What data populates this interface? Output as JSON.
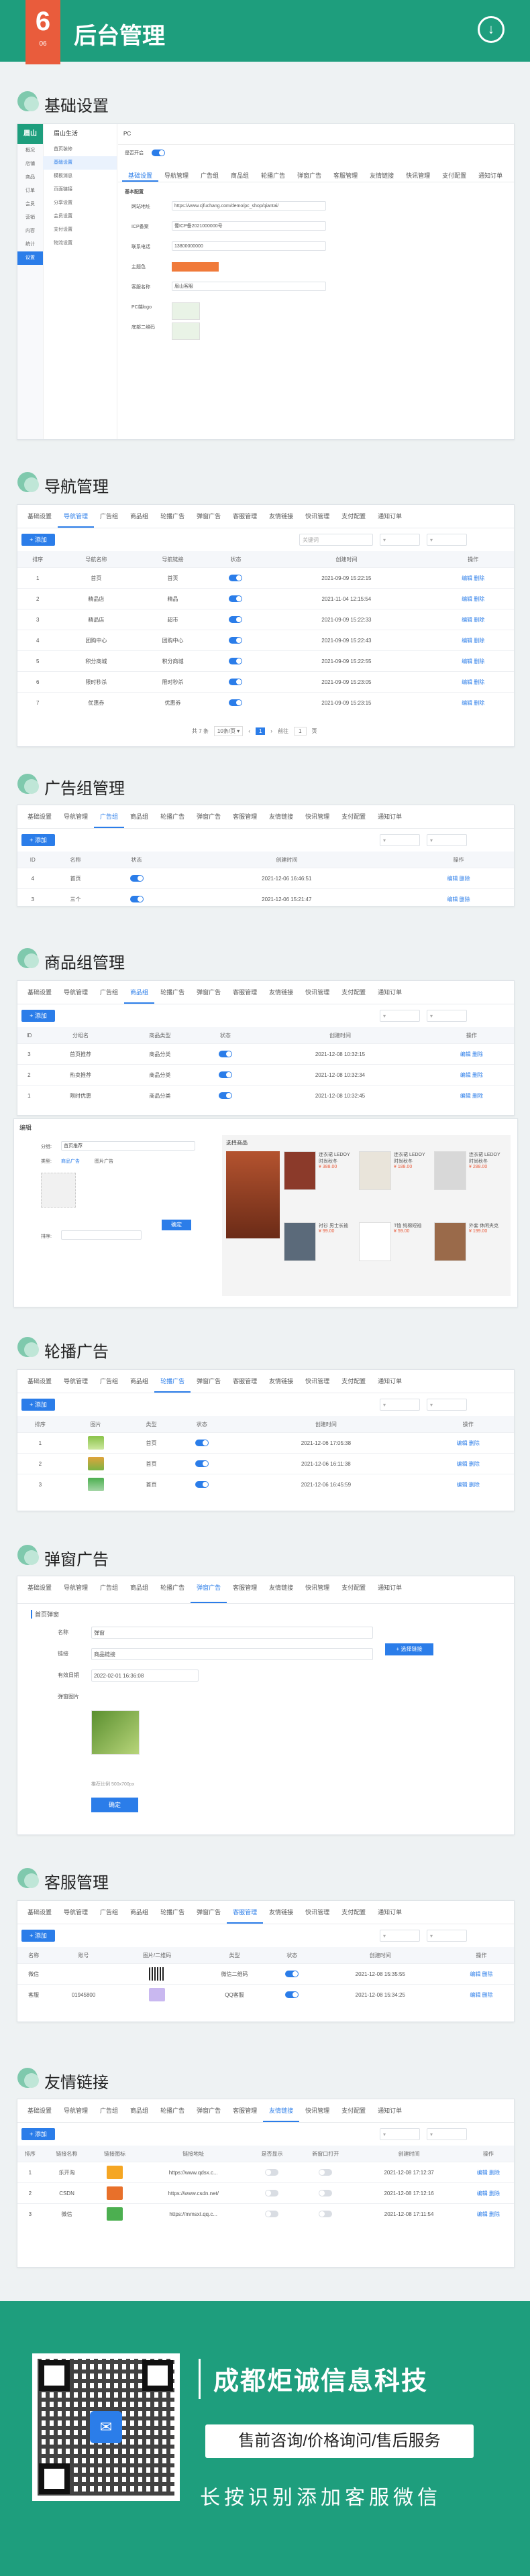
{
  "banner": {
    "number": "6",
    "number_sub": "06",
    "title": "后台管理",
    "down_icon": "arrow-down-circle-icon"
  },
  "sections": {
    "basic": "基础设置",
    "nav": "导航管理",
    "adgroup": "广告组管理",
    "goodsgroup": "商品组管理",
    "carousel": "轮播广告",
    "popup": "弹窗广告",
    "service": "客服管理",
    "links": "友情链接"
  },
  "tabs": [
    "基础设置",
    "导航管理",
    "广告组",
    "商品组",
    "轮播广告",
    "弹窗广告",
    "客服管理",
    "友情链接",
    "快讯管理",
    "支付配置",
    "通知订单"
  ],
  "common": {
    "add": "+ 添加",
    "search_ph": "关键词",
    "op_edit": "编辑",
    "op_del": "删除"
  },
  "basic_settings": {
    "logo": "眉山",
    "site_name": "眉山生活",
    "menu": [
      "概况",
      "店铺",
      "商品",
      "订单",
      "会员",
      "营销",
      "内容",
      "统计",
      "设置"
    ],
    "sub_menu": [
      "首页装修",
      "基础设置",
      "模板消息",
      "页面链接",
      "分享设置",
      "会员设置",
      "支付设置",
      "物流设置"
    ],
    "breadcrumb": "PC",
    "toggle_label": "是否开启",
    "section_title": "基本配置",
    "fields": [
      {
        "label": "网站地址",
        "value": "https://www.cjfuchang.com/demo/pc_shop/qiantai/"
      },
      {
        "label": "ICP备案",
        "value": "蜀ICP备2021000000号"
      },
      {
        "label": "联系电话",
        "value": "13800000000"
      },
      {
        "label": "主题色",
        "value": "#f07a3a"
      },
      {
        "label": "客服名称",
        "value": "眉山客服"
      },
      {
        "label": "PC端logo",
        "value": ""
      },
      {
        "label": "底部二维码",
        "value": ""
      }
    ]
  },
  "nav_table": {
    "headers": [
      "排序",
      "导航名称",
      "导航链接",
      "状态",
      "创建时间",
      "操作"
    ],
    "rows": [
      {
        "sort": "1",
        "name": "首页",
        "link": "首页",
        "time": "2021-09-09 15:22:15"
      },
      {
        "sort": "2",
        "name": "精品店",
        "link": "精品",
        "time": "2021-11-04 12:15:54"
      },
      {
        "sort": "3",
        "name": "精品店",
        "link": "超市",
        "time": "2021-09-09 15:22:33"
      },
      {
        "sort": "4",
        "name": "团购中心",
        "link": "团购中心",
        "time": "2021-09-09 15:22:43"
      },
      {
        "sort": "5",
        "name": "积分商城",
        "link": "积分商城",
        "time": "2021-09-09 15:22:55"
      },
      {
        "sort": "6",
        "name": "限时秒杀",
        "link": "限时秒杀",
        "time": "2021-09-09 15:23:05"
      },
      {
        "sort": "7",
        "name": "优惠券",
        "link": "优惠券",
        "time": "2021-09-09 15:23:15"
      }
    ],
    "pager": {
      "total": "共 7 条",
      "size": "10条/页",
      "page": "1",
      "goto": "前往",
      "goto_page": "1",
      "unit": "页"
    }
  },
  "adgroup_table": {
    "headers": [
      "ID",
      "名称",
      "状态",
      "创建时间",
      "操作"
    ],
    "rows": [
      {
        "id": "4",
        "name": "首页",
        "time": "2021-12-06 16:46:51"
      },
      {
        "id": "3",
        "name": "三个",
        "time": "2021-12-06 15:21:47"
      }
    ]
  },
  "goods_table": {
    "headers": [
      "ID",
      "分组名",
      "商品类型",
      "状态",
      "创建时间",
      "操作"
    ],
    "rows": [
      {
        "id": "3",
        "name": "首页推荐",
        "type": "商品分类",
        "time": "2021-12-08 10:32:15"
      },
      {
        "id": "2",
        "name": "热卖推荐",
        "type": "商品分类",
        "time": "2021-12-08 10:32:34"
      },
      {
        "id": "1",
        "name": "限时优惠",
        "type": "商品分类",
        "time": "2021-12-08 10:32:45"
      }
    ]
  },
  "goods_edit": {
    "title": "编辑",
    "group_label": "分组:",
    "group_value": "首页推荐",
    "type_label": "类型:",
    "type_opts": [
      "商品广告",
      "图片广告"
    ],
    "sort_label": "排序:",
    "preview_title": "选择商品",
    "products": [
      {
        "name": "连衣裙 LEDOY 时尚秋冬",
        "price": "¥ 388.00"
      },
      {
        "name": "连衣裙 LEDOY 时尚秋冬",
        "price": "¥ 188.00"
      },
      {
        "name": "连衣裙 LEDOY 时尚秋冬",
        "price": "¥ 288.00"
      },
      {
        "name": "衬衫 男士长袖",
        "price": "¥ 99.00"
      },
      {
        "name": "T恤 纯棉短袖",
        "price": "¥ 59.00"
      },
      {
        "name": "外套 休闲夹克",
        "price": "¥ 199.00"
      }
    ],
    "confirm": "确定"
  },
  "carousel_table": {
    "headers": [
      "排序",
      "图片",
      "类型",
      "状态",
      "创建时间",
      "操作"
    ],
    "rows": [
      {
        "sort": "1",
        "type": "首页",
        "time": "2021-12-06 17:05:38"
      },
      {
        "sort": "2",
        "type": "首页",
        "time": "2021-12-06 16:11:38"
      },
      {
        "sort": "3",
        "type": "首页",
        "time": "2021-12-06 16:45:59"
      }
    ]
  },
  "popup_form": {
    "section_title": "首页弹窗",
    "fields": [
      {
        "label": "名称",
        "value": "弹窗"
      },
      {
        "label": "链接",
        "value": "商品链接"
      },
      {
        "label": "有效日期",
        "value": "2022-02-01 16:36:08"
      },
      {
        "label": "弹窗图片",
        "value": ""
      }
    ],
    "select_link": "+ 选择链接",
    "hint": "推荐比例 500x700px",
    "submit": "确定"
  },
  "service_table": {
    "headers": [
      "名称",
      "账号",
      "图片/二维码",
      "类型",
      "状态",
      "创建时间",
      "操作"
    ],
    "rows": [
      {
        "name": "微信",
        "account": "",
        "type": "微信二维码",
        "time": "2021-12-08 15:35:55"
      },
      {
        "name": "客服",
        "account": "01945800",
        "type": "QQ客服",
        "time": "2021-12-08 15:34:25"
      }
    ]
  },
  "links_table": {
    "headers": [
      "排序",
      "链接名称",
      "链接图标",
      "链接地址",
      "是否显示",
      "新窗口打开",
      "创建时间",
      "操作"
    ],
    "rows": [
      {
        "sort": "1",
        "name": "乐开淘",
        "url": "https://www.qdsx.c...",
        "time": "2021-12-08 17:12:37"
      },
      {
        "sort": "2",
        "name": "CSDN",
        "url": "https://www.csdn.net/",
        "time": "2021-12-08 17:12:16"
      },
      {
        "sort": "3",
        "name": "微信",
        "url": "https://mmsxt.qq.c...",
        "time": "2021-12-08 17:11:54"
      }
    ]
  },
  "footer": {
    "company": "成都炬诚信息科技",
    "service": "售前咨询/价格询问/售后服务",
    "hint": "长按识别添加客服微信",
    "qr_icon": "chat-bubble-icon"
  },
  "colors": {
    "brand": "#1e9e7d",
    "accent": "#2b7de9",
    "ribbon": "#e95c3c"
  }
}
